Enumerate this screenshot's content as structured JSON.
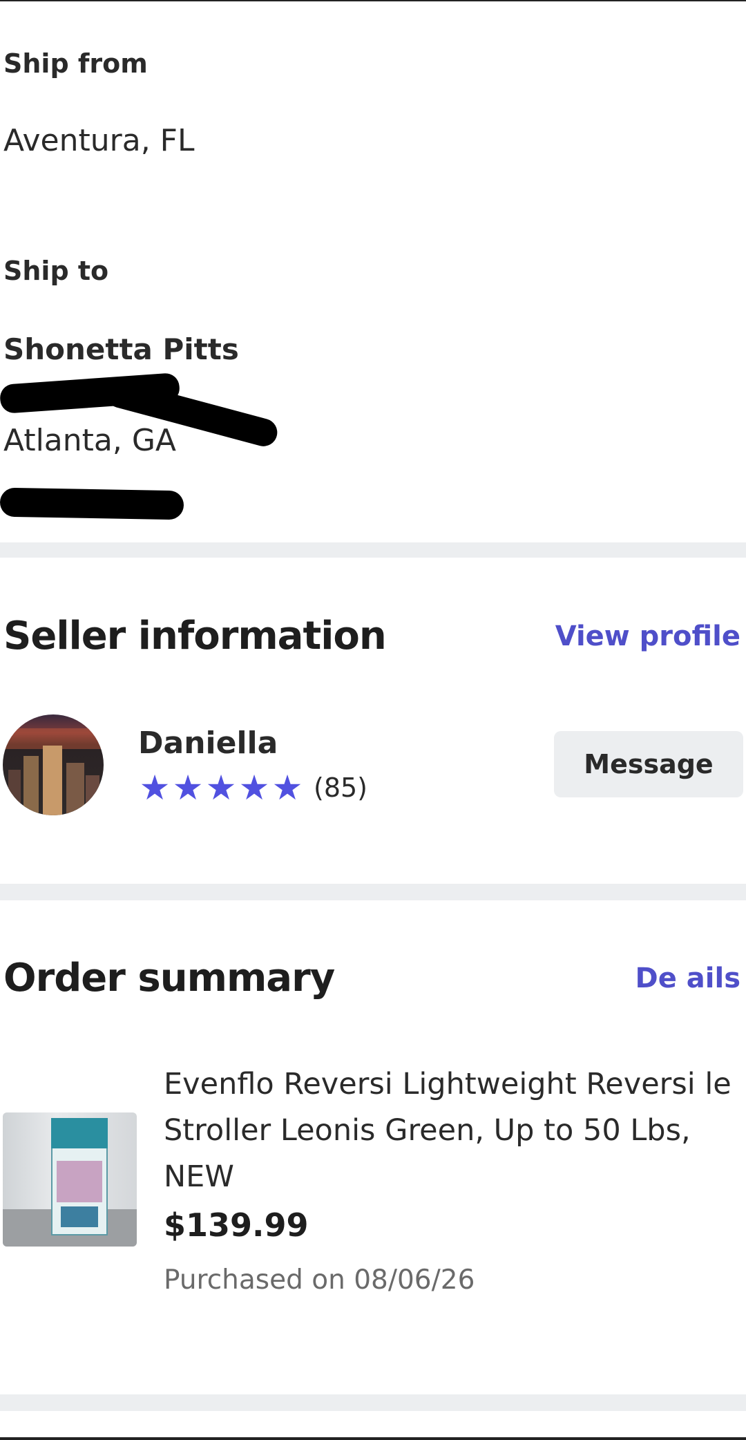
{
  "shipping": {
    "from_label": "Ship from",
    "from_value": "Aventura, FL",
    "to_label": "Ship to",
    "to_name": "Shonetta Pitts",
    "to_city": "Atlanta, GA"
  },
  "seller": {
    "section_title": "Seller information",
    "view_profile_label": "View profile",
    "name": "Daniella",
    "rating_stars": 5,
    "rating_count": "(85)",
    "message_label": "Message"
  },
  "order": {
    "section_title": "Order summary",
    "details_label": "De ails",
    "product_title": "Evenflo Reversi Lightweight Reversi le Stroller Leonis Green, Up to 50 Lbs, NEW",
    "price": "$139.99",
    "purchased_text": "Purchased on 08/06/26"
  },
  "colors": {
    "accent": "#5151e0",
    "link": "#4f4fc9",
    "divider": "#eceef0"
  }
}
